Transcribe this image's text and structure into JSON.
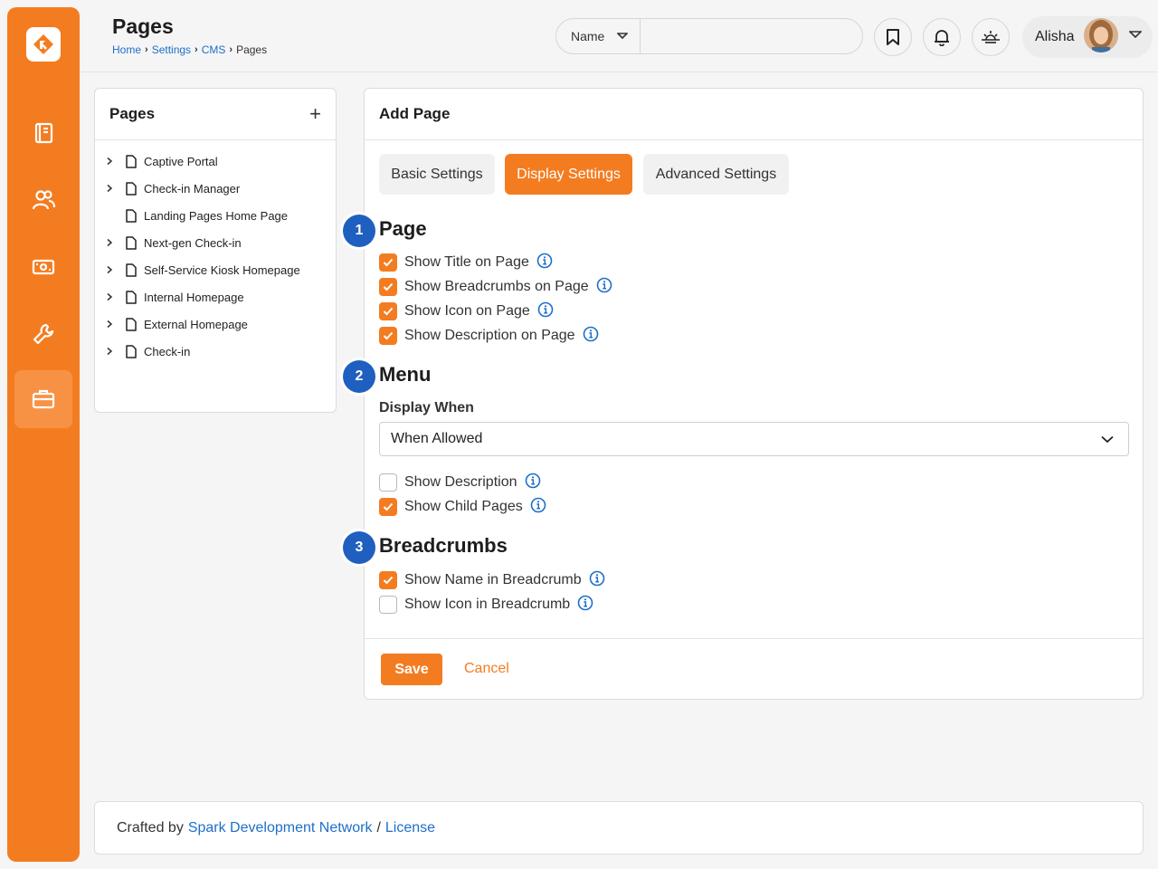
{
  "header": {
    "title": "Pages",
    "breadcrumb": [
      "Home",
      "Settings",
      "CMS",
      "Pages"
    ],
    "search": {
      "scope": "Name",
      "placeholder": ""
    },
    "user": {
      "name": "Alisha"
    }
  },
  "sidebar": {
    "items": [
      {
        "icon": "book-icon"
      },
      {
        "icon": "people-icon"
      },
      {
        "icon": "money-icon"
      },
      {
        "icon": "wrench-icon"
      },
      {
        "icon": "briefcase-icon",
        "active": true
      }
    ]
  },
  "tree": {
    "title": "Pages",
    "items": [
      {
        "label": "Captive Portal",
        "expandable": true
      },
      {
        "label": "Check-in Manager",
        "expandable": true
      },
      {
        "label": "Landing Pages Home Page",
        "expandable": false
      },
      {
        "label": "Next-gen Check-in",
        "expandable": true
      },
      {
        "label": "Self-Service Kiosk Homepage",
        "expandable": true
      },
      {
        "label": "Internal Homepage",
        "expandable": true
      },
      {
        "label": "External Homepage",
        "expandable": true
      },
      {
        "label": "Check-in",
        "expandable": true
      }
    ]
  },
  "main": {
    "title": "Add Page",
    "tabs": [
      "Basic Settings",
      "Display Settings",
      "Advanced Settings"
    ],
    "active_tab": "Display Settings",
    "sections": {
      "page": {
        "badge": "1",
        "title": "Page",
        "options": [
          {
            "label": "Show Title on Page",
            "checked": true
          },
          {
            "label": "Show Breadcrumbs on Page",
            "checked": true
          },
          {
            "label": "Show Icon on Page",
            "checked": true
          },
          {
            "label": "Show Description on Page",
            "checked": true
          }
        ]
      },
      "menu": {
        "badge": "2",
        "title": "Menu",
        "display_when_label": "Display When",
        "display_when_value": "When Allowed",
        "options": [
          {
            "label": "Show Description",
            "checked": false
          },
          {
            "label": "Show Child Pages",
            "checked": true
          }
        ]
      },
      "breadcrumbs": {
        "badge": "3",
        "title": "Breadcrumbs",
        "options": [
          {
            "label": "Show Name in Breadcrumb",
            "checked": true
          },
          {
            "label": "Show Icon in Breadcrumb",
            "checked": false
          }
        ]
      }
    },
    "save_label": "Save",
    "cancel_label": "Cancel"
  },
  "footer": {
    "prefix": "Crafted by",
    "link1": "Spark Development Network",
    "separator": "/",
    "link2": "License"
  },
  "colors": {
    "accent": "#f47c20",
    "badge": "#1f5fbf",
    "link": "#1e6fc9"
  }
}
